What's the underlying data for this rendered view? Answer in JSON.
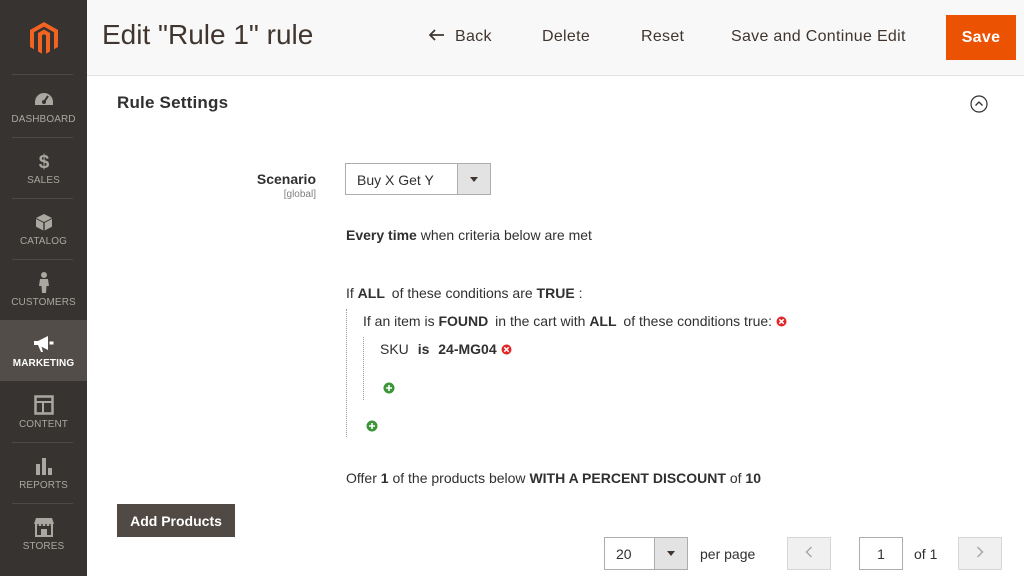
{
  "sidebar": {
    "items": [
      {
        "label": "DASHBOARD",
        "icon": "dashboard-icon"
      },
      {
        "label": "SALES",
        "icon": "dollar-icon"
      },
      {
        "label": "CATALOG",
        "icon": "box-icon"
      },
      {
        "label": "CUSTOMERS",
        "icon": "person-icon"
      },
      {
        "label": "MARKETING",
        "icon": "megaphone-icon",
        "active": true
      },
      {
        "label": "CONTENT",
        "icon": "layout-icon"
      },
      {
        "label": "REPORTS",
        "icon": "bar-chart-icon"
      },
      {
        "label": "STORES",
        "icon": "storefront-icon"
      }
    ]
  },
  "header": {
    "title": "Edit \"Rule 1\" rule",
    "back_label": "Back",
    "delete_label": "Delete",
    "reset_label": "Reset",
    "save_continue_label": "Save and Continue Edit",
    "save_label": "Save"
  },
  "section": {
    "title": "Rule Settings",
    "scenario": {
      "label": "Scenario",
      "scope": "[global]",
      "value": "Buy X Get Y"
    },
    "every_time": {
      "bold": "Every time",
      "rest": "when criteria below are met"
    },
    "conditions": {
      "if_text": "If",
      "all_text": "ALL",
      "of_these": "of these conditions are",
      "true_text": "TRUE",
      "colon": ":",
      "item_prefix": "If an item is",
      "found_text": "FOUND",
      "in_cart": "in the cart with",
      "all_text_2": "ALL",
      "conditions_true": "of these conditions true:",
      "sku_label": "SKU",
      "is_text": "is",
      "sku_value": "24-MG04"
    },
    "offer": {
      "offer_text": "Offer",
      "qty": "1",
      "of_products": "of the products below",
      "discount_type": "WITH A PERCENT DISCOUNT",
      "of_text": "of",
      "amount": "10"
    }
  },
  "grid": {
    "add_products_label": "Add Products",
    "per_page_value": "20",
    "per_page_label": "per page",
    "page_value": "1",
    "of_total": "of 1"
  },
  "colors": {
    "sidebar_bg": "#373330",
    "brand_accent": "#eb5202",
    "button_dark": "#514943"
  }
}
